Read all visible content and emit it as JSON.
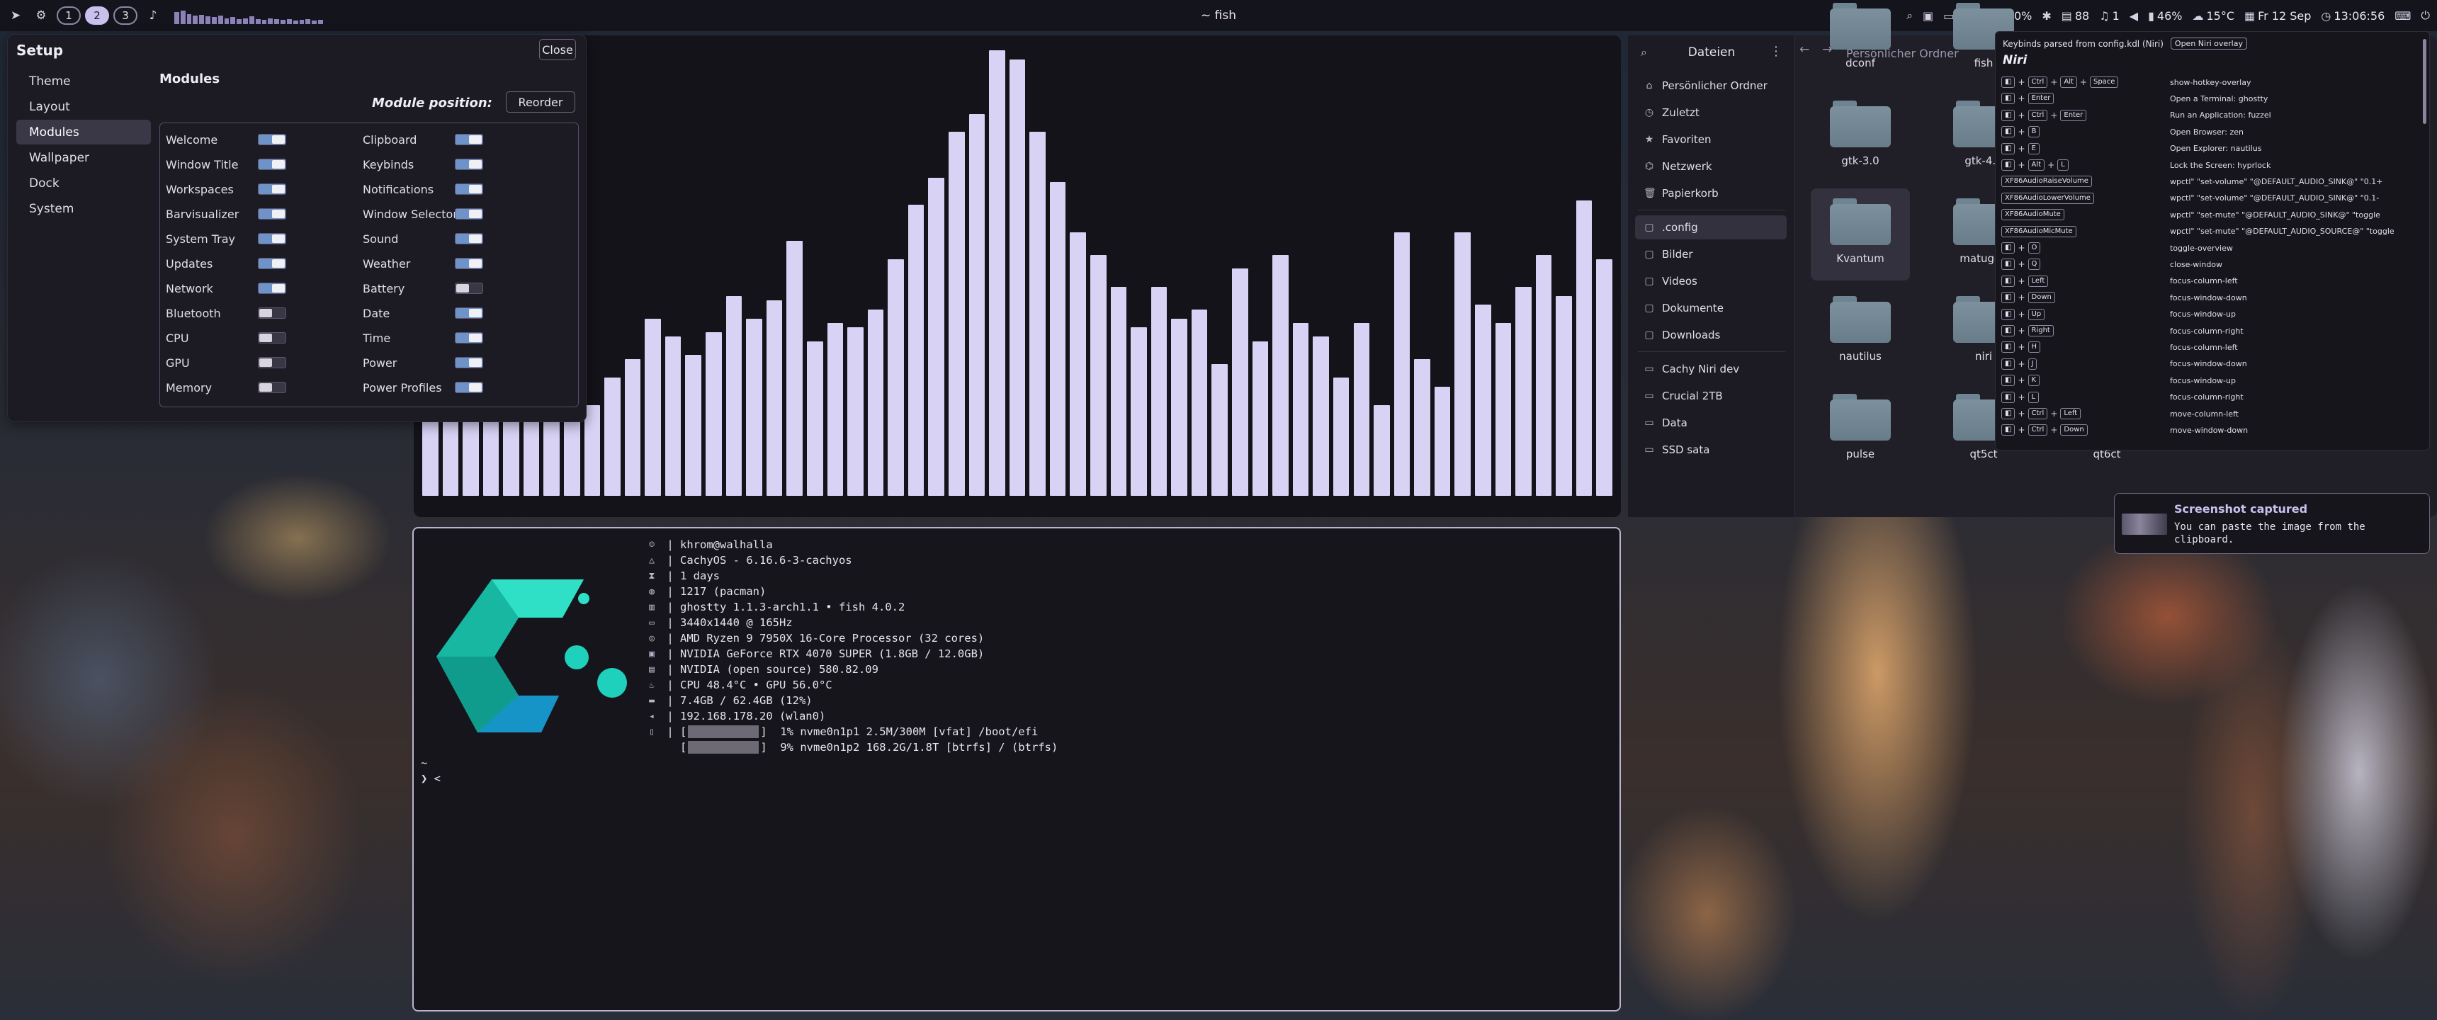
{
  "topbar": {
    "workspaces": [
      "1",
      "2",
      "3"
    ],
    "active_workspace": "2",
    "window_title": "~ fish",
    "status": {
      "brightness": "8",
      "wifi": "90%",
      "volume_icon_value": "88",
      "notifications": "1",
      "battery": "46%",
      "weather": "15°C",
      "date": "Fr 12 Sep",
      "time": "13:06:56"
    }
  },
  "setup": {
    "title": "Setup",
    "close_label": "Close",
    "nav": [
      "Theme",
      "Layout",
      "Modules",
      "Wallpaper",
      "Dock",
      "System"
    ],
    "active_nav": "Modules",
    "heading": "Modules",
    "module_position_label": "Module position:",
    "reorder_label": "Reorder",
    "modules_left": [
      {
        "name": "Welcome",
        "on": true
      },
      {
        "name": "Window Title",
        "on": true
      },
      {
        "name": "Workspaces",
        "on": true
      },
      {
        "name": "Barvisualizer",
        "on": true
      },
      {
        "name": "System Tray",
        "on": true
      },
      {
        "name": "Updates",
        "on": true
      },
      {
        "name": "Network",
        "on": true
      },
      {
        "name": "Bluetooth",
        "on": false
      },
      {
        "name": "CPU",
        "on": false
      },
      {
        "name": "GPU",
        "on": false
      },
      {
        "name": "Memory",
        "on": false
      }
    ],
    "modules_right": [
      {
        "name": "Clipboard",
        "on": true
      },
      {
        "name": "Keybinds",
        "on": true
      },
      {
        "name": "Notifications",
        "on": true
      },
      {
        "name": "Window Selector",
        "on": true
      },
      {
        "name": "Sound",
        "on": true
      },
      {
        "name": "Weather",
        "on": true
      },
      {
        "name": "Battery",
        "on": false
      },
      {
        "name": "Date",
        "on": true
      },
      {
        "name": "Time",
        "on": true
      },
      {
        "name": "Power",
        "on": true
      },
      {
        "name": "Power Profiles",
        "on": true
      }
    ]
  },
  "visualizer": {
    "levels": [
      0.22,
      0.22,
      0.22,
      0.22,
      0.22,
      0.22,
      0.22,
      0.22,
      0.2,
      0.26,
      0.3,
      0.39,
      0.35,
      0.31,
      0.36,
      0.44,
      0.39,
      0.43,
      0.56,
      0.34,
      0.38,
      0.37,
      0.41,
      0.52,
      0.64,
      0.7,
      0.8,
      0.84,
      0.98,
      0.96,
      0.8,
      0.69,
      0.58,
      0.53,
      0.46,
      0.37,
      0.46,
      0.39,
      0.41,
      0.29,
      0.5,
      0.34,
      0.53,
      0.38,
      0.35,
      0.26,
      0.38,
      0.2,
      0.58,
      0.3,
      0.24,
      0.58,
      0.42,
      0.38,
      0.46,
      0.53,
      0.44,
      0.65,
      0.52
    ]
  },
  "files": {
    "title": "Dateien",
    "breadcrumb": "Persönlicher Ordner",
    "places": [
      "Persönlicher Ordner",
      "Zuletzt",
      "Favoriten",
      "Netzwerk",
      "Papierkorb"
    ],
    "bookmarks": [
      ".config",
      "Bilder",
      "Videos",
      "Dokumente",
      "Downloads"
    ],
    "devices": [
      "Cachy Niri dev",
      "Crucial 2TB",
      "Data",
      "SSD sata"
    ],
    "folders": [
      {
        "name": "dconf",
        "row": 0,
        "col": 0
      },
      {
        "name": "fish",
        "row": 0,
        "col": 1
      },
      {
        "name": "gtk-3.0",
        "row": 1,
        "col": 0
      },
      {
        "name": "gtk-4.0",
        "row": 1,
        "col": 1
      },
      {
        "name": "Kvantum",
        "row": 2,
        "col": 0,
        "selected": true
      },
      {
        "name": "matugen",
        "row": 2,
        "col": 1
      },
      {
        "name": "nautilus",
        "row": 3,
        "col": 0
      },
      {
        "name": "niri",
        "row": 3,
        "col": 1
      },
      {
        "name": "pulse",
        "row": 4,
        "col": 0
      },
      {
        "name": "qt5ct",
        "row": 4,
        "col": 1
      },
      {
        "name": "qt6ct",
        "row": 4,
        "col": 2
      }
    ]
  },
  "keybinds": {
    "header": "Keybinds parsed from config.kdl (Niri)",
    "open_overlay_label": "Open Niri overlay",
    "section": "Niri",
    "rows": [
      {
        "keys": [
          "Ctrl",
          "Alt",
          "Space"
        ],
        "action": "show-hotkey-overlay"
      },
      {
        "keys": [
          "Enter"
        ],
        "action": "Open a Terminal: ghostty"
      },
      {
        "keys": [
          "Ctrl",
          "Enter"
        ],
        "action": "Run an Application: fuzzel"
      },
      {
        "keys": [
          "B"
        ],
        "action": "Open Browser: zen"
      },
      {
        "keys": [
          "E"
        ],
        "action": "Open Explorer: nautilus"
      },
      {
        "keys": [
          "Alt",
          "L"
        ],
        "action": "Lock the Screen: hyprlock"
      },
      {
        "keys": [
          "XF86AudioRaiseVolume"
        ],
        "bare": true,
        "action": "wpctl\" \"set-volume\" \"@DEFAULT_AUDIO_SINK@\" \"0.1+"
      },
      {
        "keys": [
          "XF86AudioLowerVolume"
        ],
        "bare": true,
        "action": "wpctl\" \"set-volume\" \"@DEFAULT_AUDIO_SINK@\" \"0.1-"
      },
      {
        "keys": [
          "XF86AudioMute"
        ],
        "bare": true,
        "action": "wpctl\" \"set-mute\" \"@DEFAULT_AUDIO_SINK@\" \"toggle"
      },
      {
        "keys": [
          "XF86AudioMicMute"
        ],
        "bare": true,
        "action": "wpctl\" \"set-mute\" \"@DEFAULT_AUDIO_SOURCE@\" \"toggle"
      },
      {
        "keys": [
          "O"
        ],
        "action": "toggle-overview"
      },
      {
        "keys": [
          "Q"
        ],
        "action": "close-window"
      },
      {
        "keys": [
          "Left"
        ],
        "action": "focus-column-left"
      },
      {
        "keys": [
          "Down"
        ],
        "action": "focus-window-down"
      },
      {
        "keys": [
          "Up"
        ],
        "action": "focus-window-up"
      },
      {
        "keys": [
          "Right"
        ],
        "action": "focus-column-right"
      },
      {
        "keys": [
          "H"
        ],
        "action": "focus-column-left"
      },
      {
        "keys": [
          "J"
        ],
        "action": "focus-window-down"
      },
      {
        "keys": [
          "K"
        ],
        "action": "focus-window-up"
      },
      {
        "keys": [
          "L"
        ],
        "action": "focus-column-right"
      },
      {
        "keys": [
          "Ctrl",
          "Left"
        ],
        "action": "move-column-left"
      },
      {
        "keys": [
          "Ctrl",
          "Down"
        ],
        "action": "move-window-down"
      }
    ]
  },
  "toast": {
    "title": "Screenshot captured",
    "body": "You can paste the image from the clipboard."
  },
  "terminal": {
    "fetch": [
      "khrom@walhalla",
      "CachyOS - 6.16.6-3-cachyos",
      "1 days",
      "1217 (pacman)",
      "ghostty 1.1.3-arch1.1 • fish 4.0.2",
      "3440x1440 @ 165Hz",
      "AMD Ryzen 9 7950X 16-Core Processor (32 cores)",
      "NVIDIA GeForce RTX 4070 SUPER (1.8GB / 12.0GB)",
      "NVIDIA (open source) 580.82.09",
      "CPU 48.4°C • GPU 56.0°C",
      "7.4GB / 62.4GB (12%)",
      "192.168.178.20 (wlan0)"
    ],
    "disks": [
      "  1% nvme0n1p1 2.5M/300M [vfat] /boot/efi",
      "  9% nvme0n1p2 168.2G/1.8T [btrfs] / (btrfs)"
    ],
    "prompt_dir": "~",
    "prompt": "❯ <"
  },
  "colors": {
    "accent": "#c9c0ee",
    "bars": "#d8d2f5",
    "toggle_on": "#6d93c8",
    "logo_teal": "#1fc4b0",
    "logo_blue": "#12a8d8"
  }
}
